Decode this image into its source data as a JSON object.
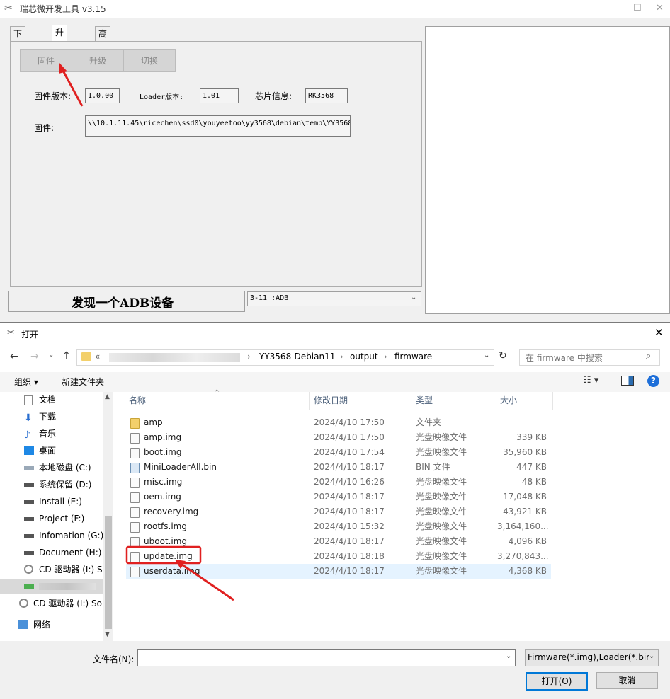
{
  "app": {
    "title": "瑞芯微开发工具 v3.15",
    "tabs": [
      "下载镜像",
      "升级固件",
      "高级功能"
    ],
    "buttons": [
      "固件",
      "升级",
      "切换"
    ],
    "fw_version_label": "固件版本:",
    "fw_version": "1.0.00",
    "loader_version_label": "Loader版本:",
    "loader_version": "1.01",
    "chip_label": "芯片信息:",
    "chip": "RK3568",
    "firmware_label": "固件:",
    "firmware_path": "\\\\10.1.11.45\\ricechen\\ssd0\\youyeetoo\\yy3568\\debian\\temp\\YY3568",
    "status": "发现一个ADB设备",
    "device": "3-11 :ADB"
  },
  "dialog": {
    "title": "打开",
    "path_prefix": "«",
    "path": [
      "YY3568-Debian11",
      "output",
      "firmware"
    ],
    "search_placeholder": "在 firmware 中搜索",
    "organize": "组织 ▾",
    "new_folder": "新建文件夹",
    "nav_items": [
      "文档",
      "下载",
      "音乐",
      "桌面",
      "本地磁盘 (C:)",
      "系统保留 (D:)",
      "Install (E:)",
      "Project (F:)",
      "Infomation (G:)",
      "Document (H:)",
      "CD 驱动器 (I:) Sc",
      "",
      "CD 驱动器 (I:) Sol",
      "网络"
    ],
    "columns": [
      "名称",
      "修改日期",
      "类型",
      "大小"
    ],
    "files": [
      {
        "name": "amp",
        "date": "2024/4/10 17:50",
        "type": "文件夹",
        "size": ""
      },
      {
        "name": "amp.img",
        "date": "2024/4/10 17:50",
        "type": "光盘映像文件",
        "size": "339 KB"
      },
      {
        "name": "boot.img",
        "date": "2024/4/10 17:54",
        "type": "光盘映像文件",
        "size": "35,960 KB"
      },
      {
        "name": "MiniLoaderAll.bin",
        "date": "2024/4/10 18:17",
        "type": "BIN 文件",
        "size": "447 KB"
      },
      {
        "name": "misc.img",
        "date": "2024/4/10 16:26",
        "type": "光盘映像文件",
        "size": "48 KB"
      },
      {
        "name": "oem.img",
        "date": "2024/4/10 18:17",
        "type": "光盘映像文件",
        "size": "17,048 KB"
      },
      {
        "name": "recovery.img",
        "date": "2024/4/10 18:17",
        "type": "光盘映像文件",
        "size": "43,921 KB"
      },
      {
        "name": "rootfs.img",
        "date": "2024/4/10 15:32",
        "type": "光盘映像文件",
        "size": "3,164,160..."
      },
      {
        "name": "uboot.img",
        "date": "2024/4/10 18:17",
        "type": "光盘映像文件",
        "size": "4,096 KB"
      },
      {
        "name": "update.img",
        "date": "2024/4/10 18:18",
        "type": "光盘映像文件",
        "size": "3,270,843..."
      },
      {
        "name": "userdata.img",
        "date": "2024/4/10 18:17",
        "type": "光盘映像文件",
        "size": "4,368 KB"
      }
    ],
    "filename_label": "文件名(N):",
    "filename_value": "",
    "filter": "Firmware(*.img),Loader(*.bin",
    "open_button": "打开(O)",
    "cancel_button": "取消"
  },
  "colors": {
    "accent": "#0078d7",
    "annotation": "#e02020",
    "selected_row": "#e5f3ff"
  }
}
